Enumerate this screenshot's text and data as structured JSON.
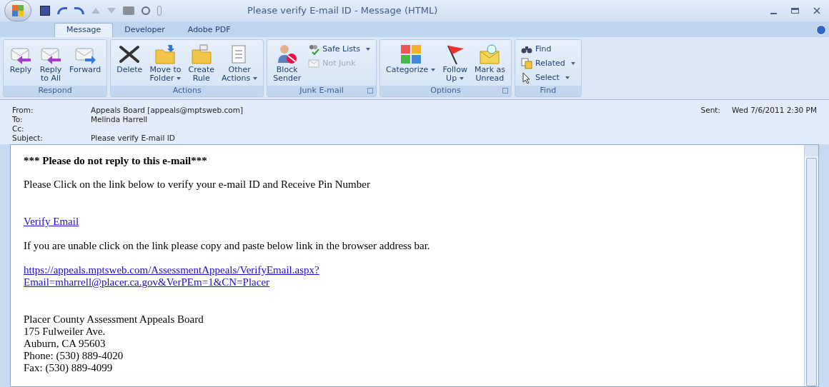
{
  "window": {
    "title": "Please verify E-mail ID - Message (HTML)"
  },
  "tabs": [
    {
      "label": "Message",
      "selected": true
    },
    {
      "label": "Developer",
      "selected": false
    },
    {
      "label": "Adobe PDF",
      "selected": false
    }
  ],
  "ribbon": [
    {
      "label": "Respond",
      "launcher": false,
      "items": [
        {
          "kind": "large",
          "lines": [
            "Reply"
          ],
          "dropdown": false,
          "disabled": false
        },
        {
          "kind": "large",
          "lines": [
            "Reply",
            "to All"
          ],
          "dropdown": false,
          "disabled": false
        },
        {
          "kind": "large",
          "lines": [
            "Forward"
          ],
          "dropdown": false,
          "disabled": false
        }
      ]
    },
    {
      "label": "Actions",
      "launcher": false,
      "items": [
        {
          "kind": "large",
          "lines": [
            "Delete"
          ],
          "dropdown": false,
          "disabled": false
        },
        {
          "kind": "large",
          "lines": [
            "Move to",
            "Folder"
          ],
          "dropdown": true,
          "disabled": false
        },
        {
          "kind": "large",
          "lines": [
            "Create",
            "Rule"
          ],
          "dropdown": false,
          "disabled": false
        },
        {
          "kind": "large",
          "lines": [
            "Other",
            "Actions"
          ],
          "dropdown": true,
          "disabled": false
        }
      ]
    },
    {
      "label": "Junk E-mail",
      "launcher": true,
      "items": [
        {
          "kind": "large",
          "lines": [
            "Block",
            "Sender"
          ],
          "dropdown": false,
          "disabled": false
        },
        {
          "kind": "small",
          "lines": [
            "Safe Lists"
          ],
          "dropdown": true,
          "disabled": false
        },
        {
          "kind": "small",
          "lines": [
            "Not Junk"
          ],
          "dropdown": false,
          "disabled": true
        }
      ]
    },
    {
      "label": "Options",
      "launcher": true,
      "items": [
        {
          "kind": "large",
          "lines": [
            "Categorize"
          ],
          "dropdown": true,
          "disabled": false
        },
        {
          "kind": "large",
          "lines": [
            "Follow",
            "Up"
          ],
          "dropdown": true,
          "disabled": false
        },
        {
          "kind": "large",
          "lines": [
            "Mark as",
            "Unread"
          ],
          "dropdown": false,
          "disabled": false
        }
      ]
    },
    {
      "label": "Find",
      "launcher": false,
      "items": [
        {
          "kind": "small",
          "lines": [
            "Find"
          ],
          "dropdown": false,
          "disabled": false
        },
        {
          "kind": "small",
          "lines": [
            "Related"
          ],
          "dropdown": true,
          "disabled": false
        },
        {
          "kind": "small",
          "lines": [
            "Select"
          ],
          "dropdown": true,
          "disabled": false
        }
      ]
    }
  ],
  "header": {
    "fields": [
      {
        "label": "From:",
        "value": "Appeals Board [appeals@mptsweb.com]"
      },
      {
        "label": "To:",
        "value": "Melinda Harrell"
      },
      {
        "label": "Cc:"
      },
      {
        "label": "Subject:",
        "value": "Please verify E-mail ID"
      }
    ],
    "sent_label": "Sent:",
    "sent_value": "Wed 7/6/2011 2:30 PM"
  },
  "body": [
    {
      "kind": "bold",
      "text": "*** Please do not reply to this e-mail***"
    },
    {
      "kind": "text",
      "text": "Please Click on the link below to verify your e-mail ID and Receive Pin Number"
    },
    {
      "kind": "link",
      "text": "Verify Email"
    },
    {
      "kind": "text",
      "text": "If you are unable click on the link please copy and paste below link in the browser address bar."
    },
    {
      "kind": "link",
      "lines": [
        "https://appeals.mptsweb.com/AssessmentAppeals/VerifyEmail.aspx?",
        "Email=mharrell@placer.ca.gov&VerPEm=1&CN=Placer"
      ]
    },
    {
      "kind": "gap"
    },
    {
      "kind": "lines",
      "lines": [
        "Placer County Assessment Appeals Board",
        "175 Fulweiler Ave.",
        "Auburn, CA 95603",
        "Phone: (530) 889-4020",
        "Fax: (530) 889-4099"
      ]
    }
  ]
}
